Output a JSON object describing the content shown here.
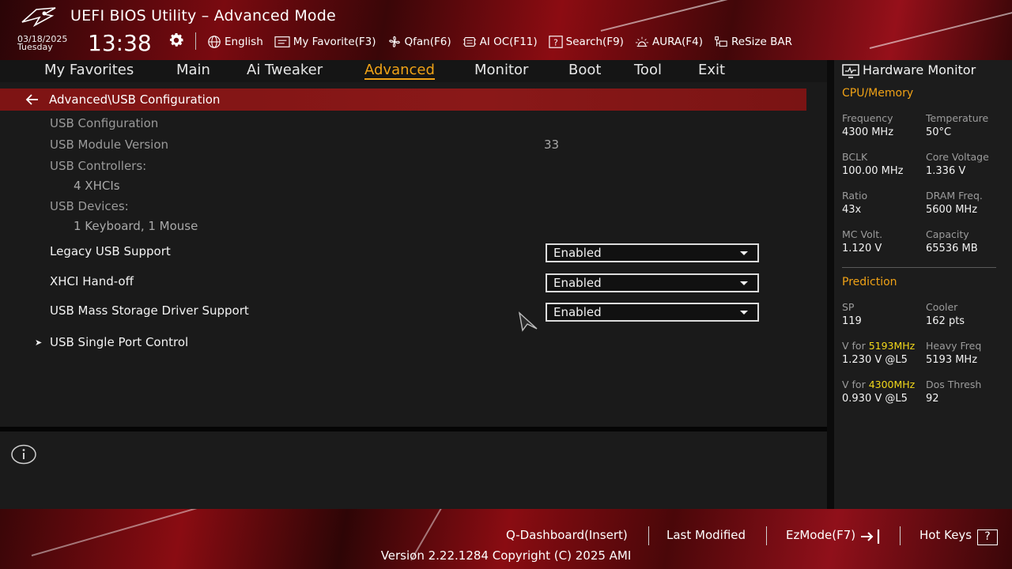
{
  "header": {
    "title": "UEFI BIOS Utility – Advanced Mode",
    "date": "03/18/2025",
    "day": "Tuesday",
    "time": "13:38",
    "tools": [
      {
        "label": "English",
        "icon": "globe-icon"
      },
      {
        "label": "My Favorite(F3)",
        "icon": "favorite-list-icon"
      },
      {
        "label": "Qfan(F6)",
        "icon": "fan-icon"
      },
      {
        "label": "AI OC(F11)",
        "icon": "ai-oc-icon"
      },
      {
        "label": "Search(F9)",
        "icon": "search-icon"
      },
      {
        "label": "AURA(F4)",
        "icon": "aura-light-icon"
      },
      {
        "label": "ReSize BAR",
        "icon": "resize-bar-icon"
      }
    ]
  },
  "nav": {
    "tabs": [
      "My Favorites",
      "Main",
      "Ai Tweaker",
      "Advanced",
      "Monitor",
      "Boot",
      "Tool",
      "Exit"
    ],
    "active": "Advanced"
  },
  "main": {
    "breadcrumb": "Advanced\\USB Configuration",
    "info_rows": {
      "usb_config": "USB Configuration",
      "module_version_label": "USB Module Version",
      "module_version_value": "33",
      "controllers_label": "USB Controllers:",
      "controllers_value": "4 XHCIs",
      "devices_label": "USB Devices:",
      "devices_value": "1 Keyboard, 1 Mouse"
    },
    "settings": [
      {
        "label": "Legacy USB Support",
        "value": "Enabled"
      },
      {
        "label": "XHCI Hand-off",
        "value": "Enabled"
      },
      {
        "label": "USB Mass Storage Driver Support",
        "value": "Enabled"
      }
    ],
    "submenu": {
      "label": "USB Single Port Control",
      "arrow": "➤"
    }
  },
  "hardware_monitor": {
    "title": "Hardware Monitor",
    "cpu_memory": {
      "section": "CPU/Memory",
      "items": [
        {
          "label": "Frequency",
          "value": "4300 MHz"
        },
        {
          "label": "Temperature",
          "value": "50°C"
        },
        {
          "label": "BCLK",
          "value": "100.00 MHz"
        },
        {
          "label": "Core Voltage",
          "value": "1.336 V"
        },
        {
          "label": "Ratio",
          "value": "43x"
        },
        {
          "label": "DRAM Freq.",
          "value": "5600 MHz"
        },
        {
          "label": "MC Volt.",
          "value": "1.120 V"
        },
        {
          "label": "Capacity",
          "value": "65536 MB"
        }
      ]
    },
    "prediction": {
      "section": "Prediction",
      "sp_label": "SP",
      "sp_value": "119",
      "cooler_label": "Cooler",
      "cooler_value": "162 pts",
      "vfor_prefix": "V for ",
      "vfor1_freq": "5193MHz",
      "vfor1_value": "1.230 V @L5",
      "heavy_label": "Heavy Freq",
      "heavy_value": "5193 MHz",
      "vfor2_freq": "4300MHz",
      "vfor2_value": "0.930 V @L5",
      "dos_label": "Dos Thresh",
      "dos_value": "92"
    }
  },
  "footer": {
    "qdashboard": "Q-Dashboard(Insert)",
    "last_modified": "Last Modified",
    "ezmode": "EzMode(F7)",
    "hotkeys": "Hot Keys",
    "hotkeys_glyph": "?",
    "version": "Version 2.22.1284 Copyright (C) 2025 AMI"
  },
  "colors": {
    "accent": "#f0a216",
    "brand_red": "#8a0c12",
    "highlight_yellow": "#f2d81a"
  }
}
